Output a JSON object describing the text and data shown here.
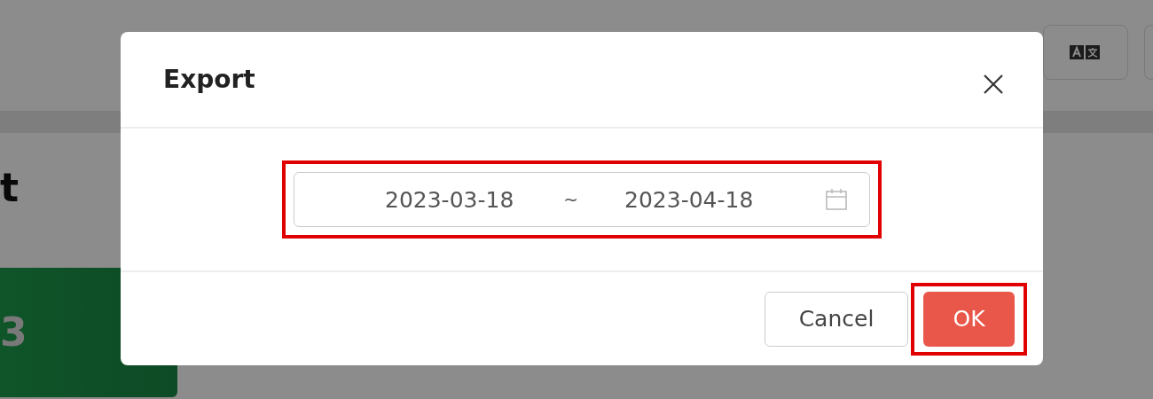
{
  "page": {
    "heading": "t",
    "stat_card": {
      "value": "3"
    }
  },
  "dialog": {
    "title": "Export",
    "date_range": {
      "start": "2023-03-18",
      "separator": "~",
      "end": "2023-04-18"
    },
    "buttons": [
      {
        "label": "Cancel",
        "kind": "secondary"
      },
      {
        "label": "OK",
        "kind": "primary"
      }
    ]
  }
}
